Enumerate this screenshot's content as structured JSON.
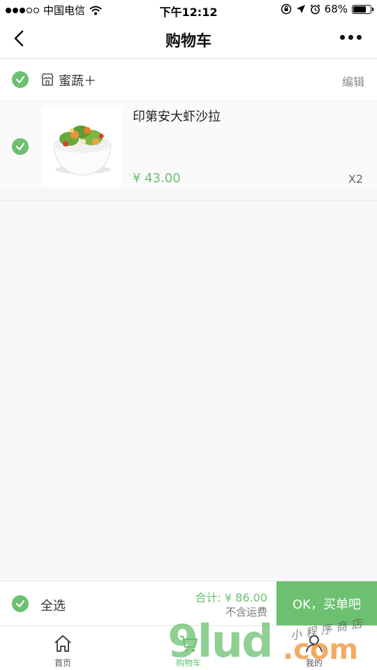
{
  "status_bar": {
    "carrier": "中国电信",
    "time": "下午12:12",
    "battery": "68%",
    "battery_level": 0.68
  },
  "nav": {
    "title": "购物车"
  },
  "shop": {
    "name": "蜜蔬＋",
    "edit_label": "编辑"
  },
  "item": {
    "name": "印第安大虾沙拉",
    "price": "¥ 43.00",
    "quantity": "X2"
  },
  "checkout": {
    "select_all_label": "全选",
    "total": "合计: ¥ 86.00",
    "shipping_note": "不含运费",
    "buy_label": "OK，买单吧"
  },
  "tabs": [
    {
      "label": "首页",
      "icon": "home-icon"
    },
    {
      "label": "购物车",
      "icon": "cart-icon"
    },
    {
      "label": "我的",
      "icon": "user-icon"
    }
  ],
  "watermark": {
    "main": "9lud",
    "domain": ".com",
    "handwritten": "小程序商店"
  },
  "colors": {
    "accent": "#6cc070",
    "background": "#f7f7f7"
  }
}
